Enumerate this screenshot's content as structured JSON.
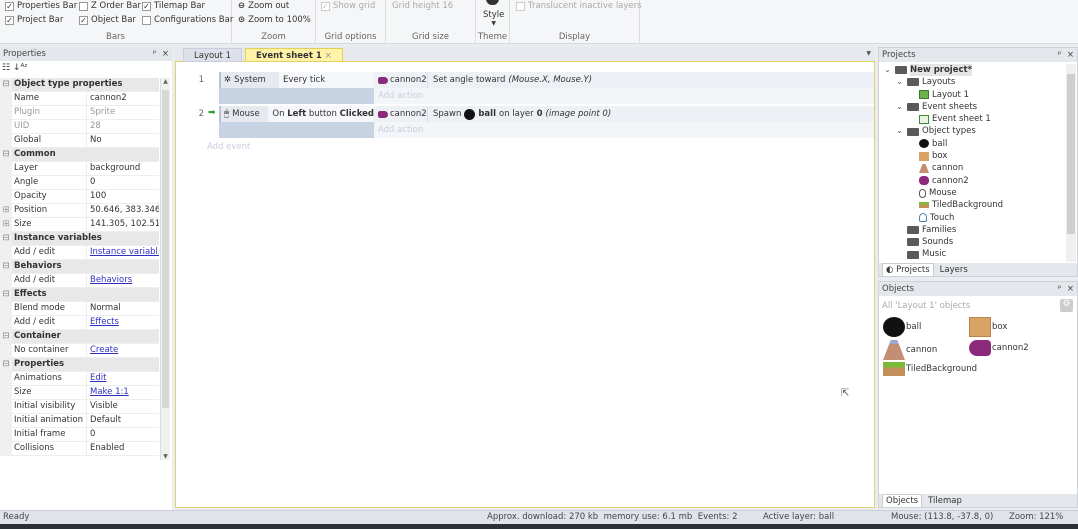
{
  "ribbon": {
    "bars": {
      "label": "Bars",
      "items": [
        {
          "label": "Properties Bar",
          "checked": true
        },
        {
          "label": "Z Order Bar",
          "checked": false
        },
        {
          "label": "Tilemap Bar",
          "checked": true
        },
        {
          "label": "Project Bar",
          "checked": true
        },
        {
          "label": "Object Bar",
          "checked": true
        },
        {
          "label": "Configurations Bar",
          "checked": false
        }
      ]
    },
    "zoom": {
      "label": "Zoom",
      "zoom_out": "Zoom out",
      "zoom_100": "Zoom to 100%"
    },
    "grid_options": {
      "label": "Grid options",
      "show_grid": "Show grid"
    },
    "grid_size": {
      "label": "Grid size",
      "grid_height": "Grid height 16"
    },
    "theme": {
      "label": "Theme",
      "style": "Style"
    },
    "display": {
      "label": "Display",
      "translucent": "Translucent inactive layers"
    }
  },
  "properties": {
    "title": "Properties",
    "rows": [
      {
        "type": "cat",
        "key": "Object type properties"
      },
      {
        "key": "Name",
        "value": "cannon2"
      },
      {
        "key": "Plugin",
        "value": "Sprite",
        "grey": true
      },
      {
        "key": "UID",
        "value": "28",
        "grey": true
      },
      {
        "key": "Global",
        "value": "No"
      },
      {
        "type": "cat",
        "key": "Common"
      },
      {
        "key": "Layer",
        "value": "background"
      },
      {
        "key": "Angle",
        "value": "0"
      },
      {
        "key": "Opacity",
        "value": "100"
      },
      {
        "key": "Position",
        "value": "50.646, 383.346",
        "expand": true
      },
      {
        "key": "Size",
        "value": "141.305, 102.51",
        "expand": true
      },
      {
        "type": "cat",
        "key": "Instance variables"
      },
      {
        "key": "Add / edit",
        "value": "Instance variabl...",
        "link": true
      },
      {
        "type": "cat",
        "key": "Behaviors"
      },
      {
        "key": "Add / edit",
        "value": "Behaviors",
        "link": true
      },
      {
        "type": "cat",
        "key": "Effects"
      },
      {
        "key": "Blend mode",
        "value": "Normal"
      },
      {
        "key": "Add / edit",
        "value": "Effects",
        "link": true
      },
      {
        "type": "cat",
        "key": "Container"
      },
      {
        "key": "No container",
        "value": "Create",
        "link": true
      },
      {
        "type": "cat",
        "key": "Properties"
      },
      {
        "key": "Animations",
        "value": "Edit",
        "link": true
      },
      {
        "key": "Size",
        "value": "Make 1:1",
        "link": true
      },
      {
        "key": "Initial visibility",
        "value": "Visible"
      },
      {
        "key": "Initial animation",
        "value": "Default"
      },
      {
        "key": "Initial frame",
        "value": "0"
      },
      {
        "key": "Collisions",
        "value": "Enabled"
      }
    ]
  },
  "tabs": [
    {
      "label": "Layout 1",
      "active": false
    },
    {
      "label": "Event sheet 1",
      "active": true
    }
  ],
  "events": [
    {
      "num": "1",
      "cond_obj": "System",
      "cond_icon": "gear-icon",
      "cond_text": "Every tick",
      "act_obj": "cannon2",
      "act_text": "Set angle toward",
      "act_args": "(Mouse.X, Mouse.Y)",
      "add_action": "Add action"
    },
    {
      "num": "2",
      "cond_obj": "Mouse",
      "cond_icon": "mouse-icon",
      "cond_pre": "On ",
      "cond_b1": "Left",
      "cond_mid": " button ",
      "cond_b2": "Clicked",
      "act_obj": "cannon2",
      "act_pre": "Spawn",
      "act_ball": "ball",
      "act_mid": "on layer",
      "act_layer": "0",
      "act_args": "(image point 0)",
      "add_action": "Add action"
    }
  ],
  "add_event": "Add event",
  "projects": {
    "title": "Projects",
    "tree": [
      {
        "label": "New project*",
        "level": 0,
        "icon": "folder",
        "chev": true,
        "bold": true
      },
      {
        "label": "Layouts",
        "level": 1,
        "icon": "folder",
        "chev": true
      },
      {
        "label": "Layout 1",
        "level": 2,
        "icon": "layout"
      },
      {
        "label": "Event sheets",
        "level": 1,
        "icon": "folder",
        "chev": true
      },
      {
        "label": "Event sheet 1",
        "level": 2,
        "icon": "eventsheet"
      },
      {
        "label": "Object types",
        "level": 1,
        "icon": "folder",
        "chev": true
      },
      {
        "label": "ball",
        "level": 2,
        "icon": "ball"
      },
      {
        "label": "box",
        "level": 2,
        "icon": "box"
      },
      {
        "label": "cannon",
        "level": 2,
        "icon": "cannon"
      },
      {
        "label": "cannon2",
        "level": 2,
        "icon": "cannon2"
      },
      {
        "label": "Mouse",
        "level": 2,
        "icon": "mouse"
      },
      {
        "label": "TiledBackground",
        "level": 2,
        "icon": "tiled"
      },
      {
        "label": "Touch",
        "level": 2,
        "icon": "touch"
      },
      {
        "label": "Families",
        "level": 1,
        "icon": "folder"
      },
      {
        "label": "Sounds",
        "level": 1,
        "icon": "folder"
      },
      {
        "label": "Music",
        "level": 1,
        "icon": "folder"
      }
    ],
    "tabs": [
      "Projects",
      "Layers"
    ]
  },
  "objects": {
    "title": "Objects",
    "filter": "All 'Layout 1' objects",
    "items": [
      "ball",
      "box",
      "cannon",
      "cannon2",
      "TiledBackground"
    ],
    "tabs": [
      "Objects",
      "Tilemap"
    ]
  },
  "status": {
    "ready": "Ready",
    "download": "Approx. download: 270 kb  memory use: 6.1 mb  Events: 2",
    "layer": "Active layer: ball",
    "mouse": "Mouse: (113.8, -37.8, 0)",
    "zoom": "Zoom: 121%"
  },
  "colors": {
    "accent_tab": "#fff3a8",
    "cannon2": "#8b2a7a"
  }
}
